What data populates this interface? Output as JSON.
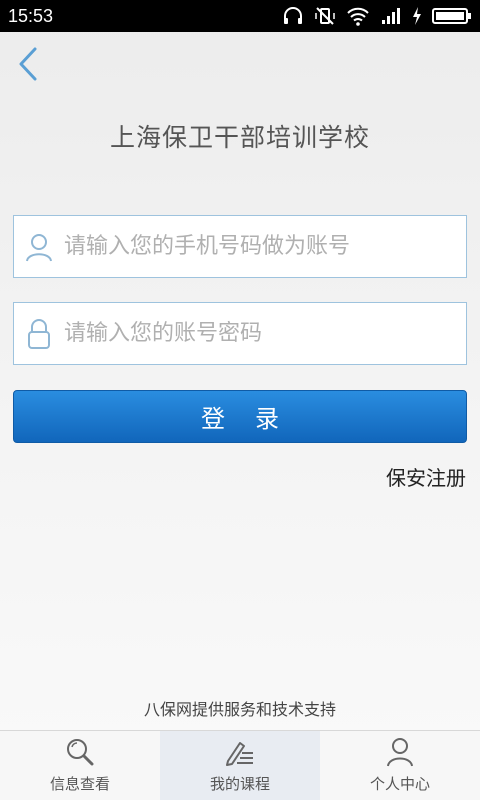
{
  "status_bar": {
    "time": "15:53"
  },
  "header": {
    "title": "上海保卫干部培训学校"
  },
  "form": {
    "phone_placeholder": "请输入您的手机号码做为账号",
    "password_placeholder": "请输入您的账号密码",
    "login_label": "登录",
    "register_label": "保安注册"
  },
  "footer": {
    "note": "八保网提供服务和技术支持"
  },
  "tabs": [
    {
      "label": "信息查看",
      "icon": "search-icon"
    },
    {
      "label": "我的课程",
      "icon": "edit-list-icon",
      "active": true
    },
    {
      "label": "个人中心",
      "icon": "person-icon"
    }
  ],
  "colors": {
    "accent": "#1a7ad0",
    "input_border": "#9ec3de"
  }
}
